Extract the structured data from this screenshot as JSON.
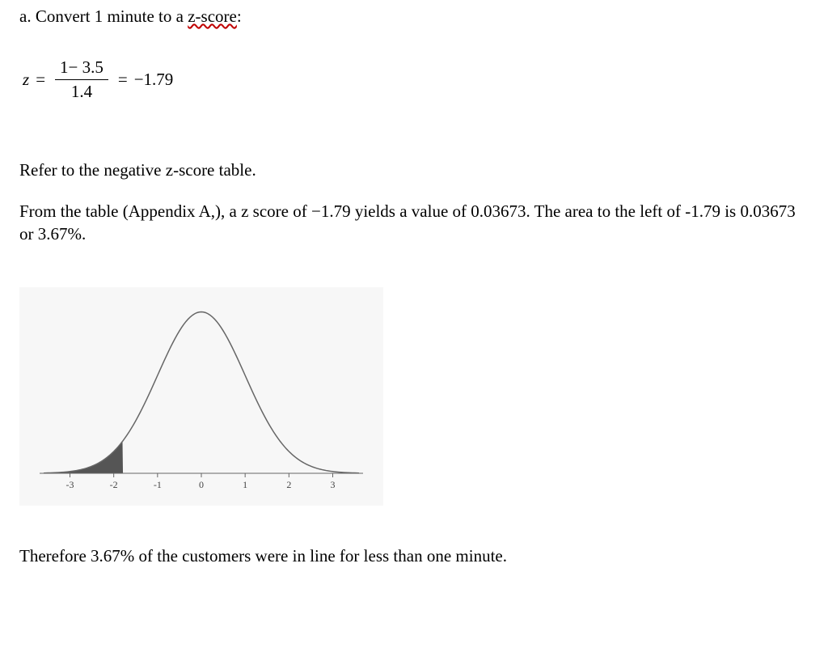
{
  "heading": {
    "prefix": "a. Convert 1 minute to a ",
    "zscore": "z-score",
    "suffix": ":"
  },
  "equation": {
    "z": "z",
    "eq1": "=",
    "numerator": "1− 3.5",
    "denominator": "1.4",
    "eq2": "=",
    "result": "−1.79"
  },
  "paragraph1": "Refer to the negative z-score table.",
  "paragraph2": "From the table (Appendix A,), a z score of −1.79 yields a value of 0.03673.  The area to the left of -1.79 is   0.03673 or 3.67%.",
  "conclusion": "Therefore 3.67% of the customers were in line for less than one minute.",
  "chart_data": {
    "type": "area",
    "title": "",
    "xlabel": "",
    "ylabel": "",
    "x_ticks": [
      -3,
      -2,
      -1,
      0,
      1,
      2,
      3
    ],
    "xlim": [
      -3.6,
      3.6
    ],
    "shaded_region": {
      "from": -3.6,
      "to": -1.79,
      "description": "left tail area shaded dark gray"
    },
    "curve": "standard_normal_pdf"
  }
}
